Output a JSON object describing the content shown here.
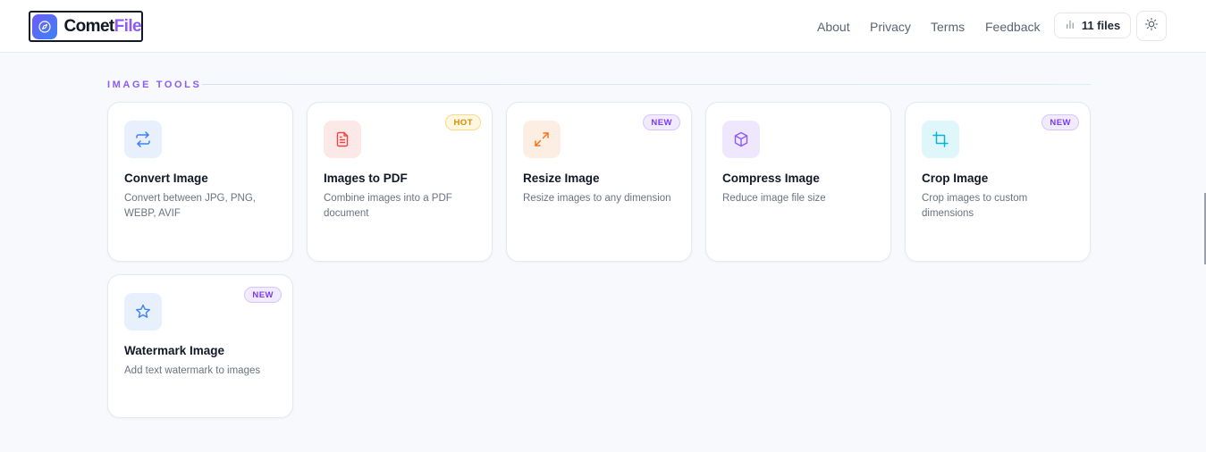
{
  "header": {
    "brand_part1": "Comet",
    "brand_part2": "File",
    "nav": [
      {
        "label": "About"
      },
      {
        "label": "Privacy"
      },
      {
        "label": "Terms"
      },
      {
        "label": "Feedback"
      }
    ],
    "files_count_label": "11 files",
    "files_icon": "bar-chart-icon",
    "theme_icon": "sun-icon"
  },
  "section": {
    "title": "IMAGE TOOLS"
  },
  "tools": [
    {
      "title": "Convert Image",
      "desc": "Convert between JPG, PNG, WEBP, AVIF",
      "badge": "",
      "icon": "arrows-swap-icon",
      "icon_bg": "#e8f0fe",
      "icon_color": "#3b82f6"
    },
    {
      "title": "Images to PDF",
      "desc": "Combine images into a PDF document",
      "badge": "HOT",
      "icon": "file-text-icon",
      "icon_bg": "#fde8e8",
      "icon_color": "#ef4444"
    },
    {
      "title": "Resize Image",
      "desc": "Resize images to any dimension",
      "badge": "NEW",
      "icon": "expand-arrows-icon",
      "icon_bg": "#fdeee3",
      "icon_color": "#f97316"
    },
    {
      "title": "Compress Image",
      "desc": "Reduce image file size",
      "badge": "",
      "icon": "box-icon",
      "icon_bg": "#efe7fd",
      "icon_color": "#8b5cf6"
    },
    {
      "title": "Crop Image",
      "desc": "Crop images to custom dimensions",
      "badge": "NEW",
      "icon": "crop-icon",
      "icon_bg": "#dff6fa",
      "icon_color": "#06b6d4"
    },
    {
      "title": "Watermark Image",
      "desc": "Add text watermark to images",
      "badge": "NEW",
      "icon": "star-icon",
      "icon_bg": "#e8f0fe",
      "icon_color": "#3b82f6"
    }
  ],
  "colors": {
    "accent": "#8b5cf6",
    "brand_blue": "#3b82f6",
    "background": "#f7f9fc"
  }
}
